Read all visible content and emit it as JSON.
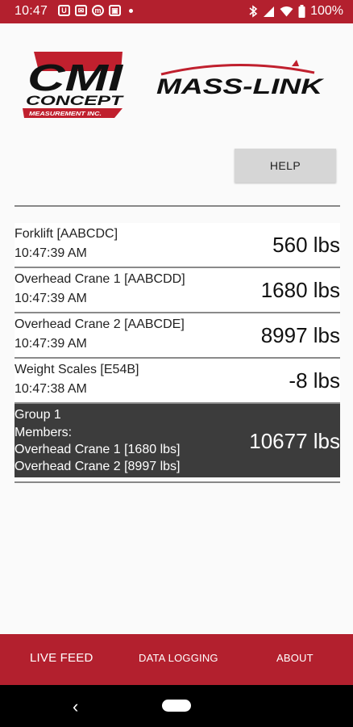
{
  "status_bar": {
    "time": "10:47",
    "notification_icons": [
      "U",
      "✉",
      "m",
      "▣"
    ],
    "battery": "100%"
  },
  "logos": {
    "cmi_main": "CMI",
    "cmi_concept": "CONCEPT",
    "cmi_sub": "MEASUREMENT INC.",
    "masslink": "MASS-LINK"
  },
  "help_label": "HELP",
  "feed": [
    {
      "name": "Forklift [AABCDC]",
      "time": "10:47:39 AM",
      "weight": "560 lbs"
    },
    {
      "name": "Overhead Crane 1 [AABCDD]",
      "time": "10:47:39 AM",
      "weight": "1680 lbs"
    },
    {
      "name": "Overhead Crane 2 [AABCDE]",
      "time": "10:47:39 AM",
      "weight": "8997 lbs"
    },
    {
      "name": "Weight Scales [E54B]",
      "time": "10:47:38 AM",
      "weight": "-8 lbs"
    }
  ],
  "group": {
    "title": "Group 1",
    "members_label": "Members:",
    "members": [
      "Overhead Crane 1 [1680 lbs]",
      "Overhead Crane 2 [8997 lbs]"
    ],
    "weight": "10677 lbs"
  },
  "nav": {
    "live_feed": "LIVE FEED",
    "data_logging": "DATA LOGGING",
    "about": "ABOUT"
  },
  "colors": {
    "brand_red": "#b3202e",
    "group_bg": "#3c3c3c",
    "help_bg": "#d6d6d6"
  }
}
